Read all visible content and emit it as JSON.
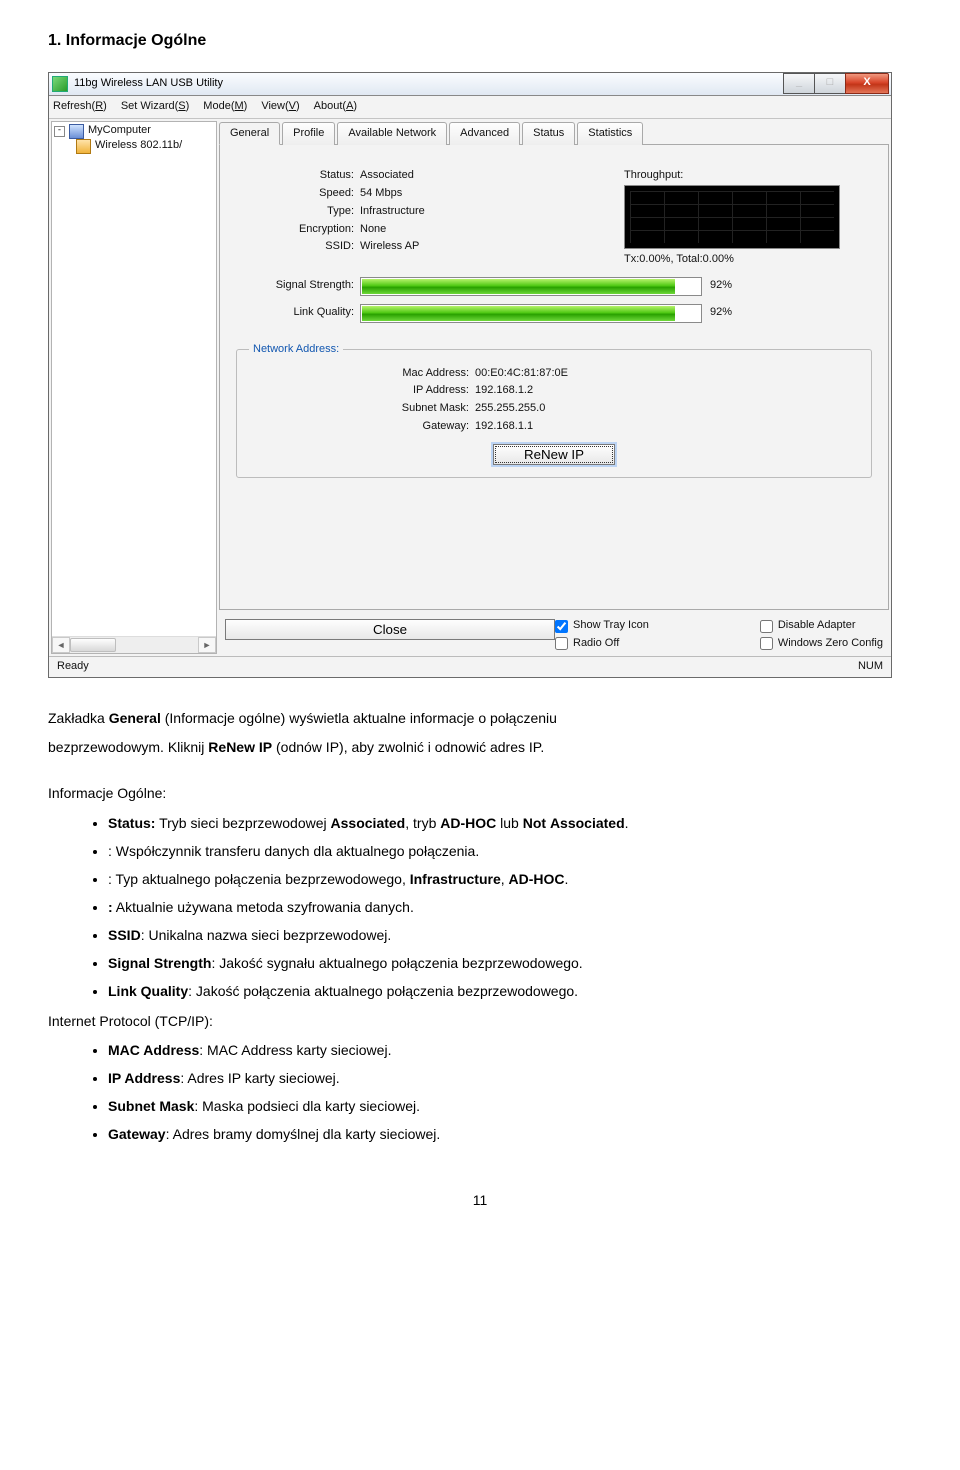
{
  "doc": {
    "heading": "1.  Informacje Ogólne",
    "intro_line1": "Zakładka General (Informacje ogólne) wyświetla aktualne informacje o połączeniu",
    "intro_line2": "bezprzewodowym. Kliknij ReNew IP (odnów IP), aby zwolnić i odnowić adres IP.",
    "section1": "Informacje Ogólne:",
    "bullets1": [
      {
        "b": "Status:",
        "rest": " Tryb sieci bezprzewodowej Associated, tryb AD-HOC lub Not Associated."
      },
      {
        "b": "",
        "rest": ": Współczynnik transferu danych dla aktualnego połączenia."
      },
      {
        "b": "",
        "rest": ": Typ aktualnego połączenia bezprzewodowego, Infrastructure, AD-HOC."
      },
      {
        "b": ":",
        "rest": " Aktualnie używana metoda szyfrowania danych."
      },
      {
        "b": "SSID",
        "rest": ": Unikalna nazwa sieci bezprzewodowej."
      },
      {
        "b": "Signal Strength",
        "rest": ": Jakość sygnału aktualnego połączenia bezprzewodowego."
      },
      {
        "b": "Link Quality",
        "rest": ": Jakość połączenia aktualnego połączenia bezprzewodowego."
      }
    ],
    "section2": "Internet Protocol (TCP/IP):",
    "bullets2": [
      {
        "b": "MAC Address",
        "rest": ": MAC Address karty sieciowej."
      },
      {
        "b": "IP Address",
        "rest": ": Adres IP karty sieciowej."
      },
      {
        "b": "Subnet Mask",
        "rest": ": Maska podsieci dla karty sieciowej."
      },
      {
        "b": "Gateway",
        "rest": ": Adres bramy domyślnej dla karty sieciowej."
      }
    ],
    "page_number": "11"
  },
  "win": {
    "title": "11bg Wireless LAN USB Utility",
    "controls": {
      "min": "_",
      "max": "□",
      "close": "X"
    },
    "menu": {
      "refresh": "Refresh(R)",
      "wizard": "Set Wizard(S)",
      "mode": "Mode(M)",
      "view": "View(V)",
      "about": "About(A)"
    },
    "tree": {
      "root": "MyComputer",
      "child": "Wireless 802.11b/"
    },
    "tabs": [
      "General",
      "Profile",
      "Available Network",
      "Advanced",
      "Status",
      "Statistics"
    ],
    "general": {
      "labels": {
        "status": "Status:",
        "speed": "Speed:",
        "type": "Type:",
        "encryption": "Encryption:",
        "ssid": "SSID:",
        "signal": "Signal Strength:",
        "link": "Link Quality:",
        "throughput": "Throughput:"
      },
      "status": "Associated",
      "speed": "54 Mbps",
      "type": "Infrastructure",
      "encryption": "None",
      "ssid": "Wireless AP",
      "signal_pct": "92%",
      "signal_fill": "92%",
      "link_pct": "92%",
      "link_fill": "92%",
      "tp_stats": "Tx:0.00%, Total:0.00%"
    },
    "netaddr": {
      "legend": "Network Address:",
      "mac_lbl": "Mac Address:",
      "mac": "00:E0:4C:81:87:0E",
      "ip_lbl": "IP Address:",
      "ip": "192.168.1.2",
      "mask_lbl": "Subnet Mask:",
      "mask": "255.255.255.0",
      "gw_lbl": "Gateway:",
      "gw": "192.168.1.1",
      "renew": "ReNew IP"
    },
    "checks": {
      "tray": "Show Tray Icon",
      "radio": "Radio Off",
      "disable": "Disable Adapter",
      "wzc": "Windows Zero Config"
    },
    "close_btn": "Close",
    "status_left": "Ready",
    "status_right": "NUM"
  }
}
